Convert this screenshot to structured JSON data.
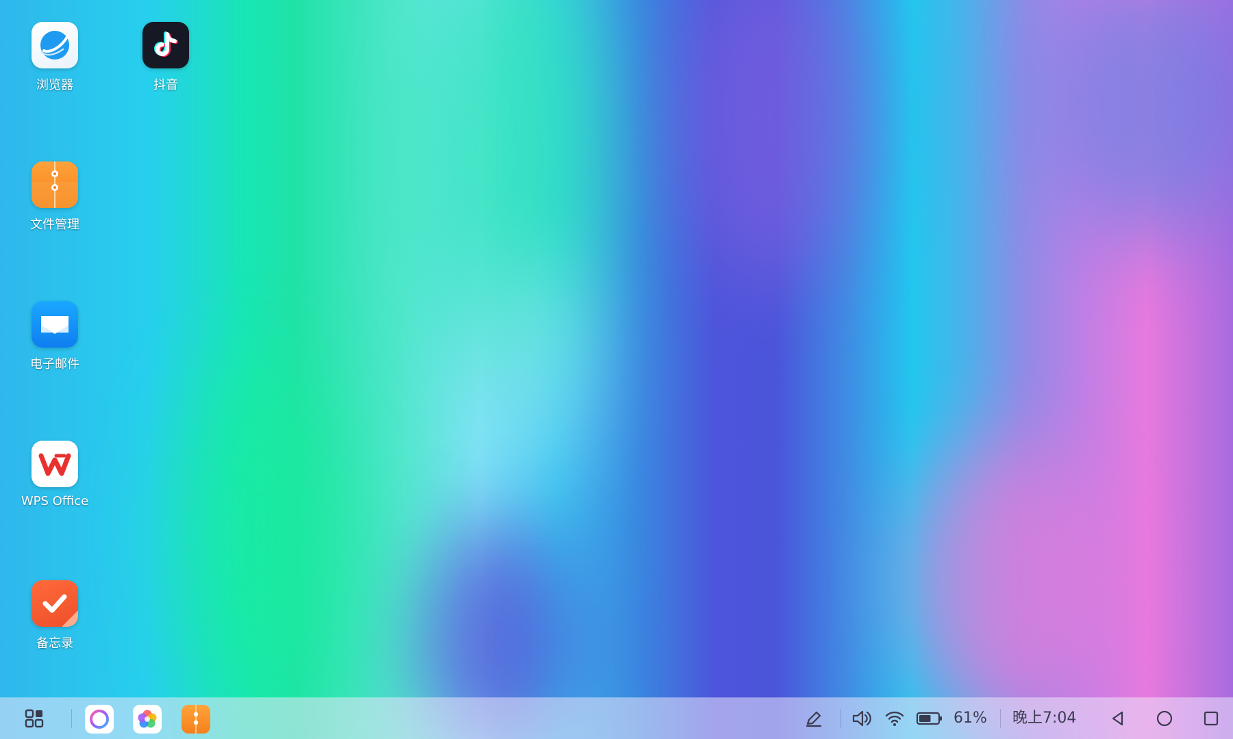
{
  "desktop": {
    "icons": [
      {
        "label": "浏览器",
        "icon": "browser-icon"
      },
      {
        "label": "抖音",
        "icon": "douyin-icon"
      },
      {
        "label": "文件管理",
        "icon": "file-manager-icon"
      },
      {
        "label": "电子邮件",
        "icon": "email-icon"
      },
      {
        "label": "WPS Office",
        "icon": "wps-office-icon"
      },
      {
        "label": "备忘录",
        "icon": "memo-icon"
      }
    ]
  },
  "taskbar": {
    "app_drawer_icon": "app-grid-icon",
    "pinned_apps": [
      {
        "icon": "assistant-ring-icon"
      },
      {
        "icon": "gallery-flower-icon"
      },
      {
        "icon": "file-manager-icon"
      }
    ],
    "tray": {
      "pen_icon": "pen-icon",
      "volume_icon": "volume-icon",
      "wifi_icon": "wifi-icon",
      "battery_icon": "battery-icon",
      "battery_level": 0.61,
      "battery_text": "61%",
      "clock": "晚上7:04"
    },
    "nav": {
      "back_icon": "back-triangle-icon",
      "home_icon": "home-circle-icon",
      "recents_icon": "recents-square-icon"
    }
  },
  "colors": {
    "tray_text": "#3a3a4e",
    "orange_accent": "#f7931e",
    "browser_blue": "#1e9bf0",
    "email_blue": "#1792f4",
    "wps_red": "#e8312f",
    "memo_orange": "#f0582e"
  }
}
